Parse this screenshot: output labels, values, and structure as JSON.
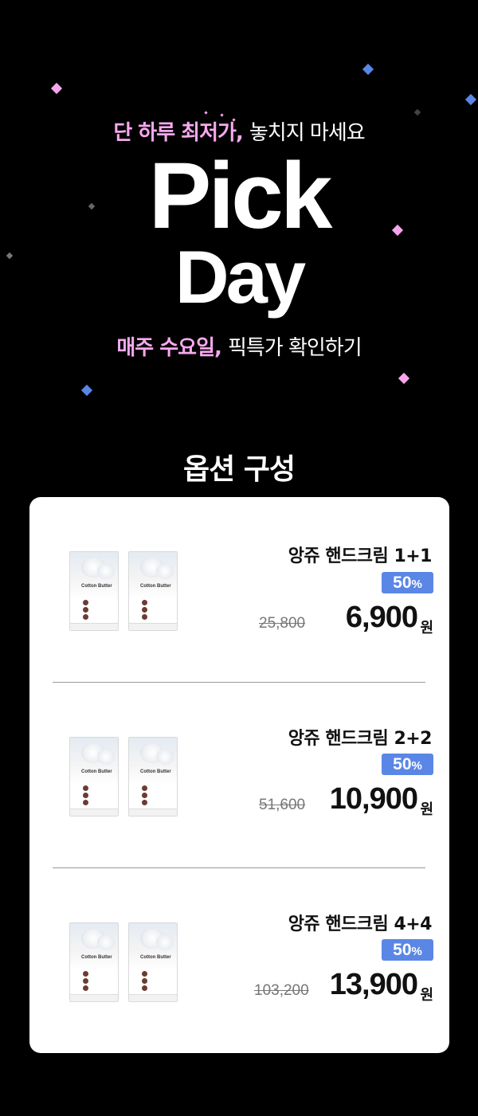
{
  "hero": {
    "tagline1_accent": "단 하루 최저가,",
    "tagline1_rest": "놓치지 마세요",
    "title_line1": "Pick",
    "title_line2": "Day",
    "tagline2_accent": "매주 수요일,",
    "tagline2_rest": "픽특가 확인하기",
    "colors": {
      "pink": "#f7a8ee",
      "blue": "#5a86e6",
      "background": "#000000"
    }
  },
  "section": {
    "title": "옵션 구성"
  },
  "options": [
    {
      "name": "앙쥬 핸드크림 1+1",
      "discount": "50",
      "discount_unit": "%",
      "original_price": "25,800",
      "price": "6,900",
      "currency": "원",
      "product_label": "Cotton Butter",
      "product_image": "cotton-butter-hand-cream-pair"
    },
    {
      "name": "앙쥬 핸드크림 2+2",
      "discount": "50",
      "discount_unit": "%",
      "original_price": "51,600",
      "price": "10,900",
      "currency": "원",
      "product_label": "Cotton Butter",
      "product_image": "cotton-butter-hand-cream-pair"
    },
    {
      "name": "앙쥬 핸드크림 4+4",
      "discount": "50",
      "discount_unit": "%",
      "original_price": "103,200",
      "price": "13,900",
      "currency": "원",
      "product_label": "Cotton Butter",
      "product_image": "cotton-butter-hand-cream-pair"
    }
  ]
}
